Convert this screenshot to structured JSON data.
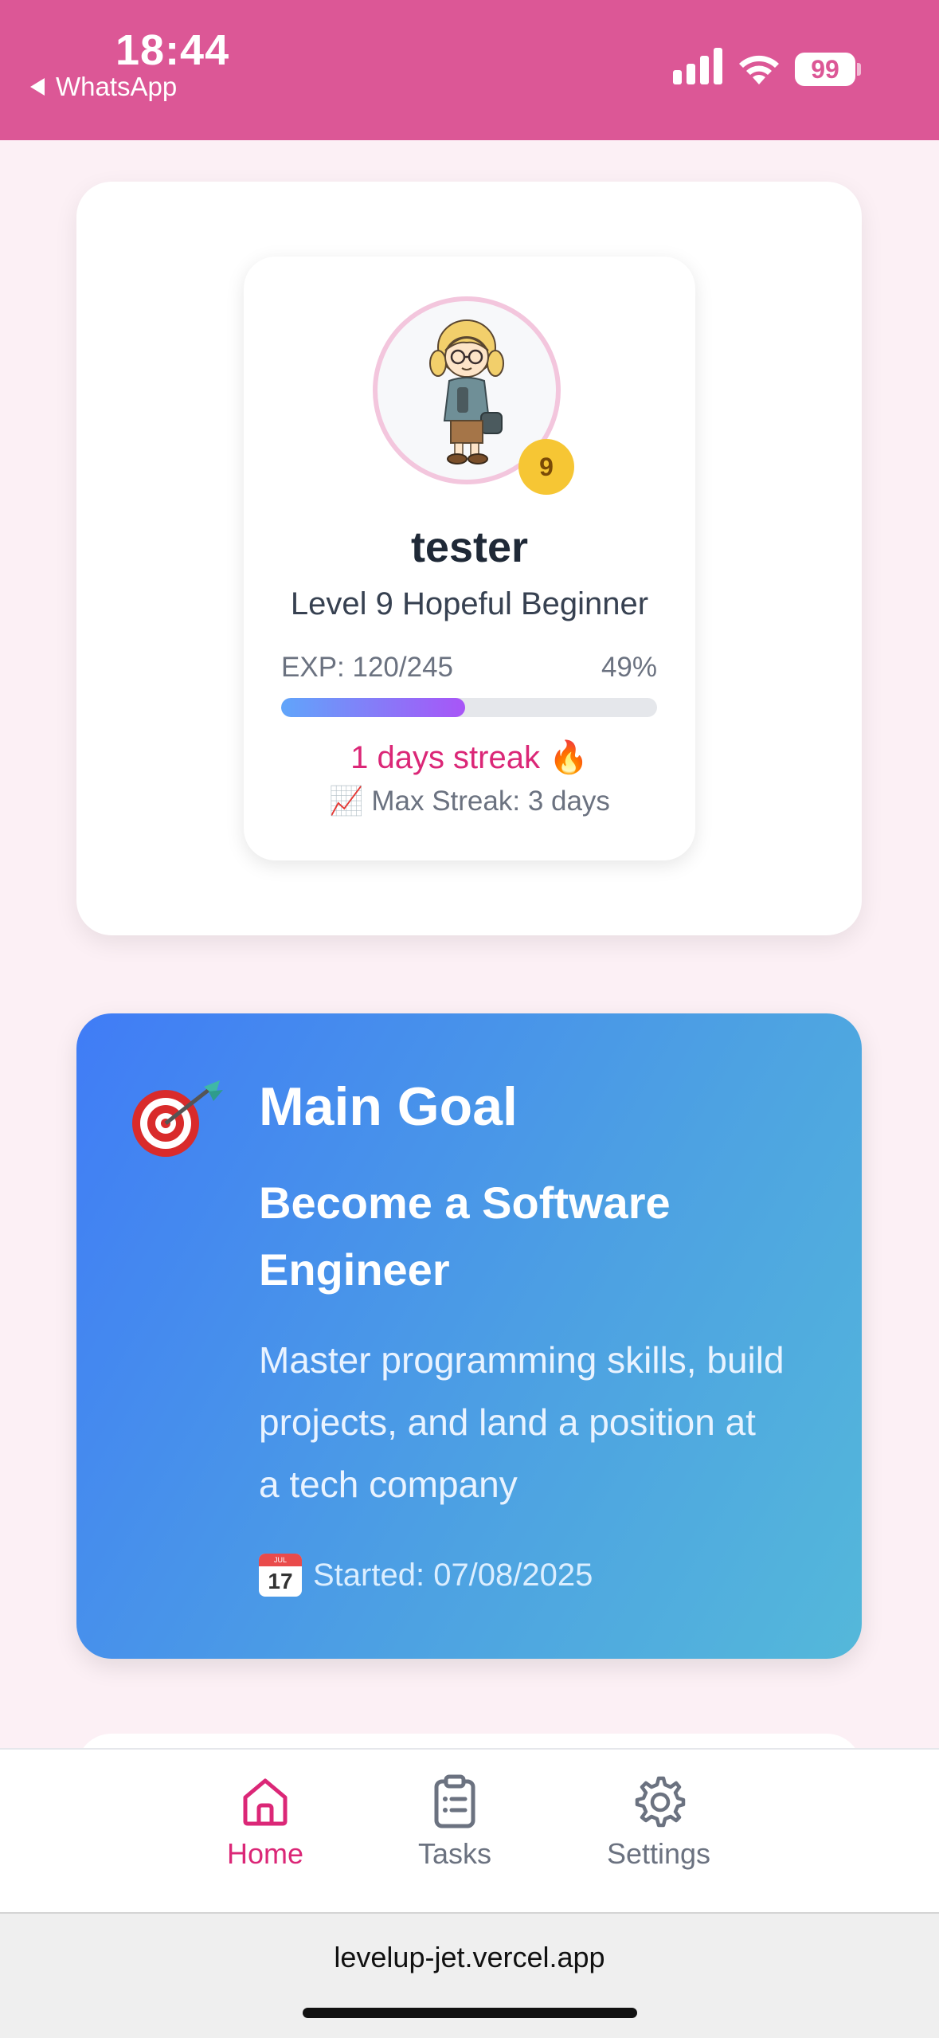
{
  "status_bar": {
    "time": "18:44",
    "back_app": "WhatsApp",
    "battery": "99"
  },
  "profile": {
    "avatar_icon": "girl-with-glasses-avatar-icon",
    "level_badge": "9",
    "username": "tester",
    "level_title": "Level 9 Hopeful Beginner",
    "exp_label": "EXP: 120/245",
    "exp_percent_text": "49%",
    "exp_progress": 0.49,
    "streak_text": "1 days streak 🔥",
    "max_streak_text": "📈 Max Streak: 3 days"
  },
  "goal": {
    "icon": "bullseye-dart-icon",
    "heading": "Main Goal",
    "title": "Become a Software Engineer",
    "description": "Master programming skills, build projects, and land a position at a tech company",
    "started_label": "Started:  07/08/2025",
    "calendar_month": "JUL",
    "calendar_day": "17"
  },
  "nav": {
    "home": "Home",
    "tasks": "Tasks",
    "settings": "Settings",
    "active": "Home",
    "active_color": "#db2777"
  },
  "browser": {
    "url": "levelup-jet.vercel.app"
  },
  "colors": {
    "header": "#dc5796",
    "page_bg": "#fcf0f5",
    "goal_gradient_start": "#407cf6",
    "goal_gradient_end": "#54b8da"
  }
}
